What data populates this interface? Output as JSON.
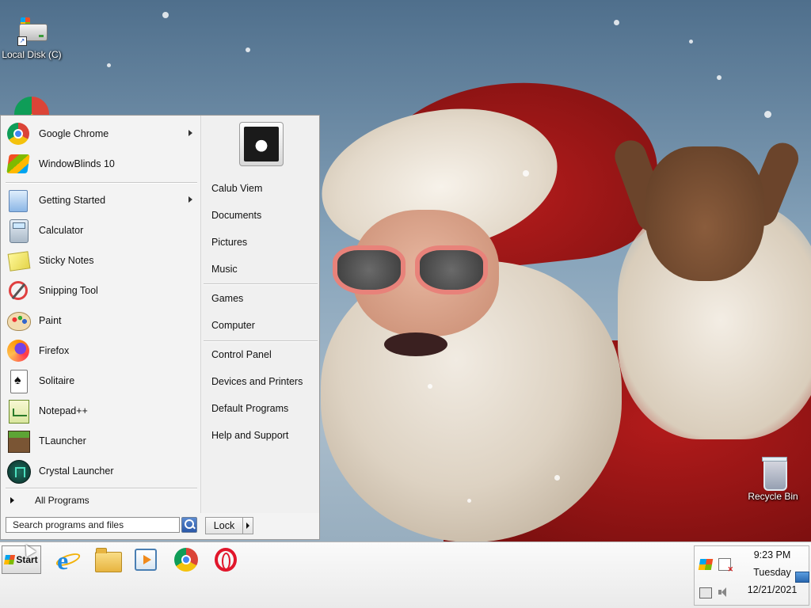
{
  "desktop": {
    "icons": [
      {
        "label": "Local Disk (C)",
        "icon": "drive-icon"
      },
      {
        "label": "Recycle Bin",
        "icon": "recycle-bin-icon"
      }
    ]
  },
  "start_menu": {
    "pinned": [
      {
        "label": "Google Chrome",
        "icon": "chrome-icon",
        "has_submenu": true
      },
      {
        "label": "WindowBlinds 10",
        "icon": "windowblinds-icon",
        "has_submenu": false
      }
    ],
    "recent": [
      {
        "label": "Getting Started",
        "icon": "getting-started-icon",
        "has_submenu": true
      },
      {
        "label": "Calculator",
        "icon": "calculator-icon",
        "has_submenu": false
      },
      {
        "label": "Sticky Notes",
        "icon": "sticky-notes-icon",
        "has_submenu": false
      },
      {
        "label": "Snipping Tool",
        "icon": "snipping-tool-icon",
        "has_submenu": false
      },
      {
        "label": "Paint",
        "icon": "paint-icon",
        "has_submenu": false
      },
      {
        "label": "Firefox",
        "icon": "firefox-icon",
        "has_submenu": false
      },
      {
        "label": "Solitaire",
        "icon": "solitaire-icon",
        "has_submenu": false
      },
      {
        "label": "Notepad++",
        "icon": "notepadpp-icon",
        "has_submenu": false
      },
      {
        "label": "TLauncher",
        "icon": "tlauncher-icon",
        "has_submenu": false
      },
      {
        "label": "Crystal Launcher",
        "icon": "crystal-launcher-icon",
        "has_submenu": false
      }
    ],
    "all_programs": "All Programs",
    "search_placeholder": "Search programs and files",
    "lock_label": "Lock",
    "user_name": "Calub Viem",
    "right_links": {
      "group1": [
        "Calub Viem",
        "Documents",
        "Pictures",
        "Music"
      ],
      "group2": [
        "Games",
        "Computer"
      ],
      "group3": [
        "Control Panel",
        "Devices and Printers",
        "Default Programs",
        "Help and Support"
      ]
    }
  },
  "taskbar": {
    "start_label": "Start",
    "pinned": [
      "internet-explorer-icon",
      "file-explorer-icon",
      "media-player-icon",
      "chrome-icon",
      "opera-icon"
    ],
    "clock": {
      "time": "9:23 PM",
      "day": "Tuesday",
      "date": "12/21/2021"
    }
  }
}
